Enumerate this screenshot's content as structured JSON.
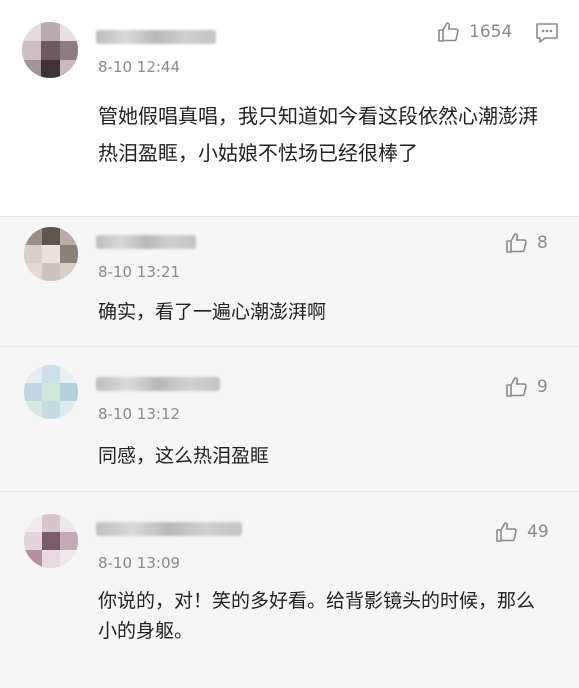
{
  "comments": [
    {
      "time": "8-10 12:44",
      "likes": "1654",
      "text": "管她假唱真唱，我只知道如今看这段依然心潮澎湃热泪盈眶，小姑娘不怯场已经很棒了"
    },
    {
      "time": "8-10 13:21",
      "likes": "8",
      "text": "确实，看了一遍心潮澎湃啊"
    },
    {
      "time": "8-10 13:12",
      "likes": "9",
      "text": "同感，这么热泪盈眶"
    },
    {
      "time": "8-10 13:09",
      "likes": "49",
      "text": "你说的，对！笑的多好看。给背影镜头的时候，那么小的身躯。"
    }
  ],
  "icons": {
    "like": "thumbs-up-icon",
    "reply": "message-icon"
  }
}
